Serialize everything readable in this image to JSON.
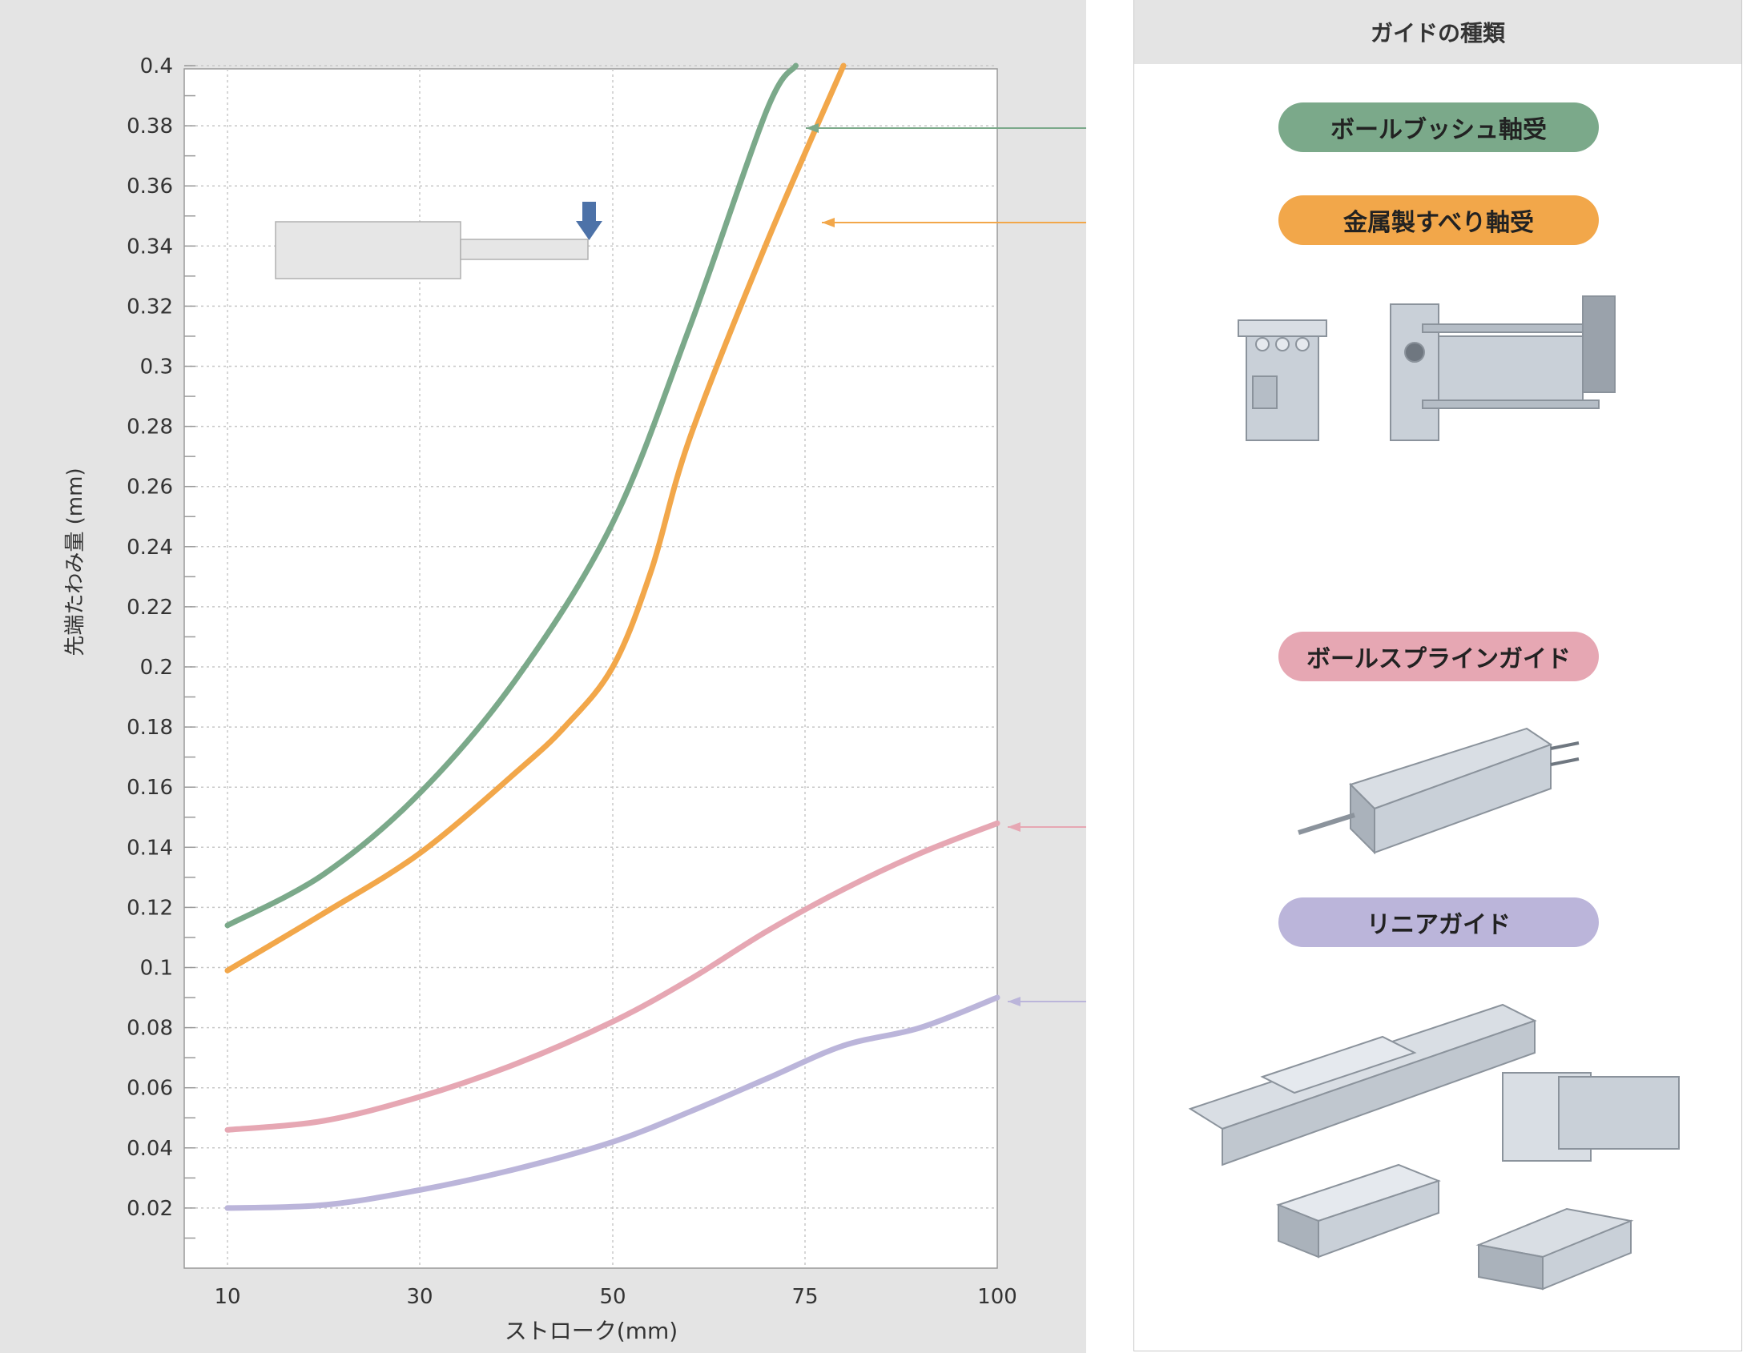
{
  "chart_data": {
    "type": "line",
    "xlabel": "ストローク(mm)",
    "ylabel": "先端たわみ量 (mm)",
    "x_ticks": [
      10,
      30,
      50,
      75,
      100
    ],
    "x_tick_labels": [
      "10",
      "30",
      "50",
      "75",
      "100"
    ],
    "y_ticks": [
      0.02,
      0.04,
      0.06,
      0.08,
      0.1,
      0.12,
      0.14,
      0.16,
      0.18,
      0.2,
      0.22,
      0.24,
      0.26,
      0.28,
      0.3,
      0.32,
      0.34,
      0.36,
      0.38,
      0.4
    ],
    "y_tick_labels": [
      "0.02",
      "0.04",
      "0.06",
      "0.08",
      "0.1",
      "0.12",
      "0.14",
      "0.16",
      "0.18",
      "0.2",
      "0.22",
      "0.24",
      "0.26",
      "0.28",
      "0.3",
      "0.32",
      "0.34",
      "0.36",
      "0.38",
      "0.4"
    ],
    "ylim": [
      0,
      0.4
    ],
    "grid": true,
    "series": [
      {
        "name": "ボールブッシュ軸受",
        "color": "#7ba98a",
        "points": [
          [
            10,
            0.114
          ],
          [
            20,
            0.131
          ],
          [
            30,
            0.158
          ],
          [
            40,
            0.196
          ],
          [
            50,
            0.248
          ],
          [
            60,
            0.313
          ],
          [
            70,
            0.385
          ],
          [
            73.8,
            0.4
          ]
        ]
      },
      {
        "name": "金属製すべり軸受",
        "color": "#f2a74a",
        "points": [
          [
            10,
            0.099
          ],
          [
            20,
            0.118
          ],
          [
            30,
            0.138
          ],
          [
            40,
            0.165
          ],
          [
            45,
            0.18
          ],
          [
            50,
            0.2
          ],
          [
            55,
            0.232
          ],
          [
            60,
            0.276
          ],
          [
            70,
            0.341
          ],
          [
            80,
            0.4
          ]
        ]
      },
      {
        "name": "ボールスプラインガイド",
        "color": "#e6a7b3",
        "points": [
          [
            10,
            0.046
          ],
          [
            20,
            0.049
          ],
          [
            30,
            0.057
          ],
          [
            40,
            0.068
          ],
          [
            50,
            0.082
          ],
          [
            60,
            0.096
          ],
          [
            70,
            0.112
          ],
          [
            80,
            0.126
          ],
          [
            90,
            0.138
          ],
          [
            100,
            0.148
          ]
        ]
      },
      {
        "name": "リニアガイド",
        "color": "#bbb5da",
        "points": [
          [
            10,
            0.02
          ],
          [
            20,
            0.021
          ],
          [
            30,
            0.026
          ],
          [
            40,
            0.033
          ],
          [
            50,
            0.042
          ],
          [
            60,
            0.052
          ],
          [
            70,
            0.063
          ],
          [
            80,
            0.074
          ],
          [
            90,
            0.08
          ],
          [
            100,
            0.09
          ]
        ]
      }
    ]
  },
  "legend": {
    "header": "ガイドの種類",
    "items": [
      {
        "label": "ボールブッシュ軸受",
        "color": "#7ba98a"
      },
      {
        "label": "金属製すべり軸受",
        "color": "#f2a74a"
      },
      {
        "label": "ボールスプラインガイド",
        "color": "#e6a7b3"
      },
      {
        "label": "リニアガイド",
        "color": "#bbb5da"
      }
    ]
  },
  "colors": {
    "panel_bg": "#e4e4e4",
    "plot_bg": "#ffffff",
    "grid": "#c8c8c8",
    "arrow_down": "#4d72a8",
    "diagram_fill": "#e6e6e6",
    "product_metal": "#c9d0d8"
  }
}
